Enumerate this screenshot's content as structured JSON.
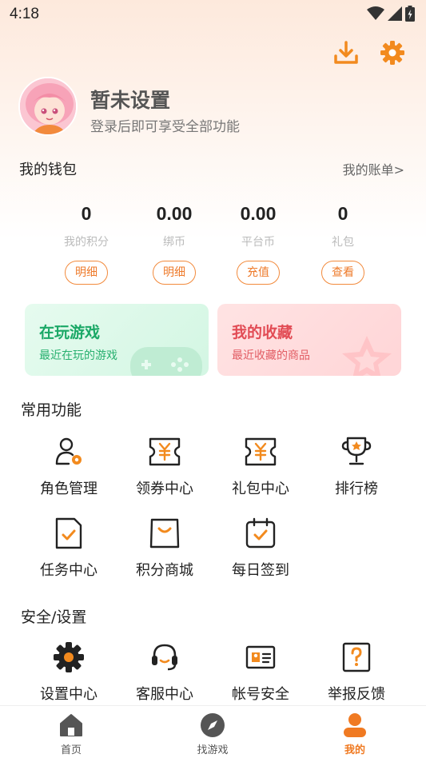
{
  "status_bar": {
    "time": "4:18"
  },
  "profile": {
    "nickname": "暂未设置",
    "subtitle": "登录后即可享受全部功能"
  },
  "wallet": {
    "title": "我的钱包",
    "bill_link": "我的账单>",
    "items": [
      {
        "value": "0",
        "label": "我的积分",
        "button": "明细"
      },
      {
        "value": "0.00",
        "label": "绑币",
        "button": "明细"
      },
      {
        "value": "0.00",
        "label": "平台币",
        "button": "充值"
      },
      {
        "value": "0",
        "label": "礼包",
        "button": "查看"
      }
    ]
  },
  "cards": {
    "playing": {
      "title": "在玩游戏",
      "subtitle": "最近在玩的游戏"
    },
    "favorites": {
      "title": "我的收藏",
      "subtitle": "最近收藏的商品"
    }
  },
  "common": {
    "title": "常用功能",
    "items": [
      {
        "label": "角色管理",
        "icon": "role-manage-icon"
      },
      {
        "label": "领券中心",
        "icon": "coupon-icon"
      },
      {
        "label": "礼包中心",
        "icon": "gift-pack-icon"
      },
      {
        "label": "排行榜",
        "icon": "trophy-icon"
      },
      {
        "label": "任务中心",
        "icon": "task-icon"
      },
      {
        "label": "积分商城",
        "icon": "points-mall-icon"
      },
      {
        "label": "每日签到",
        "icon": "calendar-check-icon"
      }
    ]
  },
  "security": {
    "title": "安全/设置",
    "items": [
      {
        "label": "设置中心",
        "icon": "settings-icon"
      },
      {
        "label": "客服中心",
        "icon": "headset-icon"
      },
      {
        "label": "帐号安全",
        "icon": "id-card-icon"
      },
      {
        "label": "举报反馈",
        "icon": "report-icon"
      }
    ]
  },
  "nav": {
    "items": [
      {
        "label": "首页",
        "icon": "home-icon"
      },
      {
        "label": "找游戏",
        "icon": "compass-icon"
      },
      {
        "label": "我的",
        "icon": "user-icon",
        "active": true
      }
    ]
  },
  "colors": {
    "accent": "#f07a22",
    "text": "#222222",
    "muted": "#bbbbbb"
  }
}
